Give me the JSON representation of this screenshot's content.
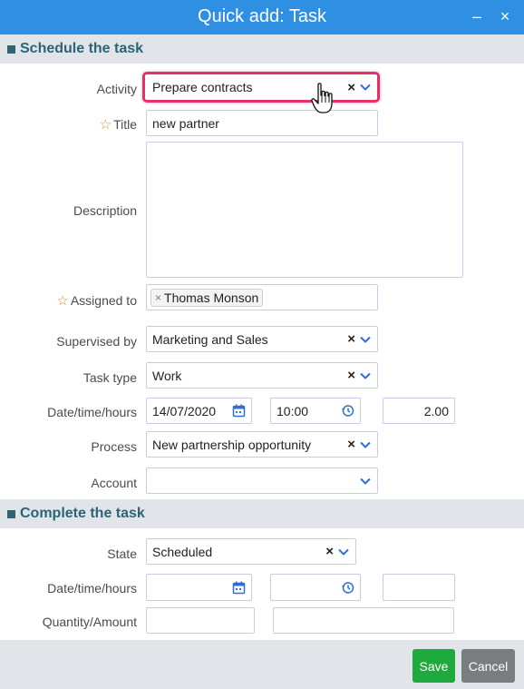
{
  "window": {
    "title": "Quick add: Task"
  },
  "sections": {
    "schedule": "Schedule the task",
    "complete": "Complete the task"
  },
  "labels": {
    "activity": "Activity",
    "title": "Title",
    "description": "Description",
    "assigned_to": "Assigned to",
    "supervised_by": "Supervised by",
    "task_type": "Task type",
    "datetime_hours": "Date/time/hours",
    "process": "Process",
    "account": "Account",
    "state": "State",
    "datetime_hours_2": "Date/time/hours",
    "quantity_amount": "Quantity/Amount"
  },
  "fields": {
    "activity": "Prepare contracts",
    "title": "new partner",
    "description": "",
    "assigned_tag": "Thomas Monson",
    "supervised_by": "Marketing and Sales",
    "task_type": "Work",
    "date": "14/07/2020",
    "time": "10:00",
    "hours": "2.00",
    "process": "New partnership opportunity",
    "account": "",
    "state": "Scheduled",
    "date2": "",
    "time2": "",
    "hours2": "",
    "quantity": "",
    "amount": ""
  },
  "buttons": {
    "save": "Save",
    "cancel": "Cancel"
  },
  "icons": {
    "clear": "×",
    "minimize": "–",
    "close": "×",
    "tag_remove": "×",
    "required": "☆"
  },
  "colors": {
    "titlebar": "#2e8fe3",
    "section_bg": "#e1e4e8",
    "section_text": "#2c6476",
    "accent_icon": "#2e6fd4",
    "required_star": "#f08c2e",
    "highlight": "#e5306a",
    "save": "#1eaa3c",
    "cancel": "#7a7d80"
  }
}
